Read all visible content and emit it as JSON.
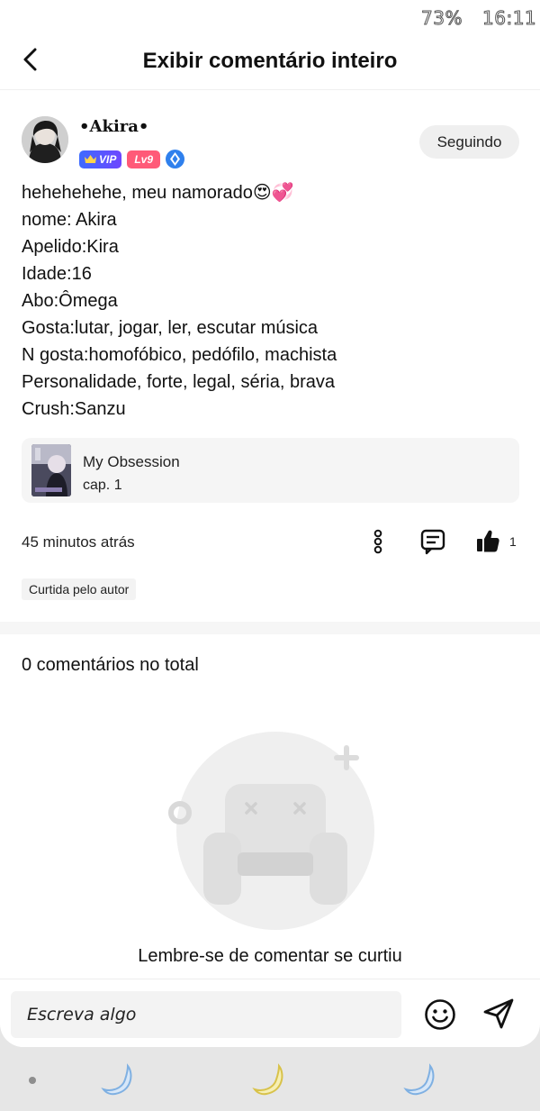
{
  "status_bar": {
    "battery": "73%",
    "time": "16:11"
  },
  "header": {
    "title": "Exibir comentário inteiro",
    "back_icon": "chevron-left-icon"
  },
  "author": {
    "name": "•Akira•",
    "badges": {
      "vip": "VIP",
      "level": "Lv9"
    },
    "follow_label": "Seguindo"
  },
  "comment": {
    "lines": [
      "hehehehehe, meu namorado😍💞",
      "nome: Akira",
      "Apelido:Kira",
      "Idade:16",
      "Abo:Ômega",
      "Gosta:lutar, jogar, ler, escutar música",
      "N gosta:homofóbico, pedófilo, machista",
      "Personalidade, forte, legal, séria, brava",
      "Crush:Sanzu"
    ]
  },
  "book": {
    "title": "My Obsession",
    "chapter": "cap. 1"
  },
  "meta": {
    "timestamp": "45 minutos atrás",
    "like_count": "1",
    "liked_by_author": "Curtida pelo autor"
  },
  "comments": {
    "total": "0 comentários no total",
    "empty_message": "Lembre-se de comentar se curtiu"
  },
  "input": {
    "placeholder": "Escreva algo"
  },
  "colors": {
    "vip": "#4a5cff",
    "level": "#ff5a78",
    "diamond": "#2f80ed",
    "illustration": "#e9e9e9",
    "moon": "#9fc6f0"
  }
}
